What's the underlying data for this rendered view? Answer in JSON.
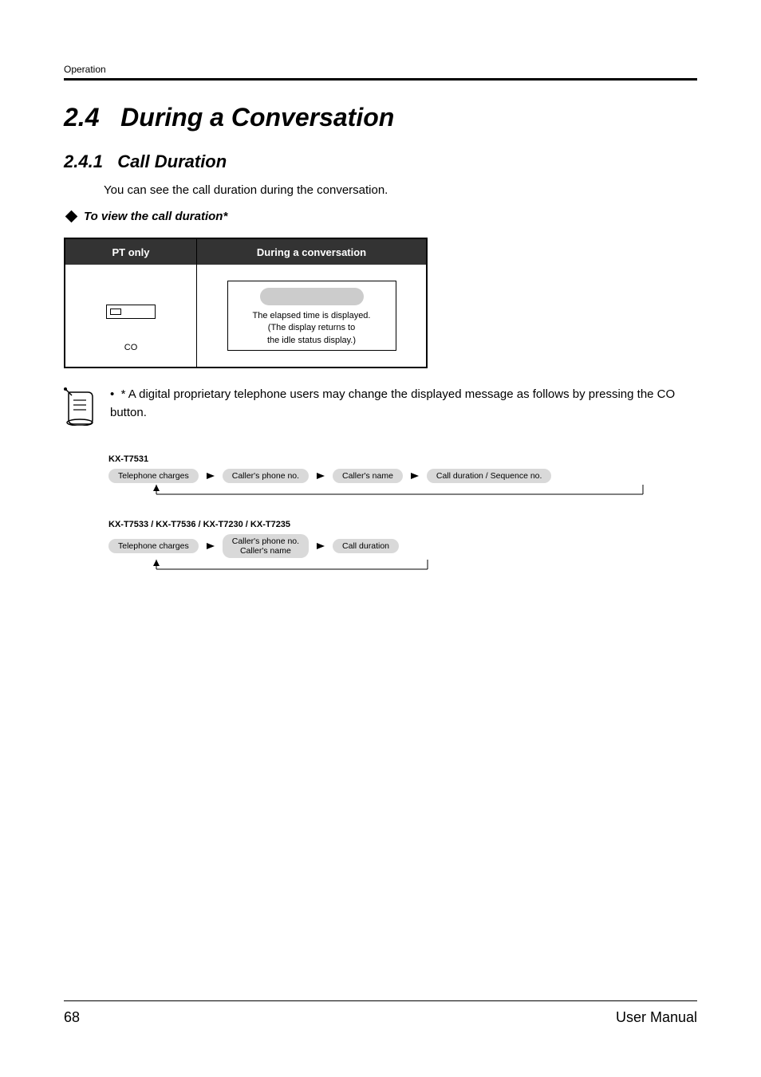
{
  "header": {
    "section": "Operation"
  },
  "section": {
    "number": "2.4",
    "title": "During a Conversation"
  },
  "subsection": {
    "number": "2.4.1",
    "title": "Call Duration"
  },
  "intro": "You can see the call duration during the conversation.",
  "subhead": "To view the call duration*",
  "table": {
    "group_label": "PT only",
    "action_label": "During a conversation",
    "co_label": "CO",
    "speech_text": "The elapsed time is displayed.\n(The display returns to\nthe idle status display.)"
  },
  "note": {
    "bullet": "•",
    "text": "* A digital proprietary telephone users may change the displayed message as follows by pressing the CO button."
  },
  "flow1": {
    "label": "KX-T7531",
    "chips": [
      "Telephone charges",
      "Caller's phone no.",
      "Caller's name",
      "Call duration / Sequence no."
    ]
  },
  "flow2": {
    "label": "KX-T7533 / KX-T7536 / KX-T7230 / KX-T7235",
    "chips": [
      "Telephone charges",
      "Caller's phone no.\nCaller's name",
      "Call duration"
    ]
  },
  "footer": {
    "page": "68",
    "manual": "User Manual"
  }
}
